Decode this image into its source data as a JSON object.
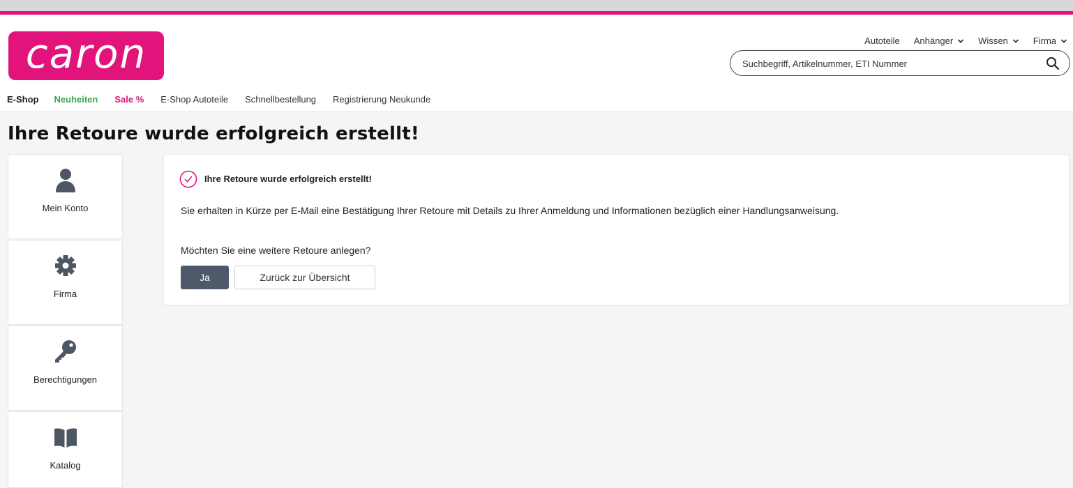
{
  "brand": {
    "logo_text": "caron",
    "accent_color": "#e2147c"
  },
  "utility_nav": [
    {
      "label": "Autoteile",
      "has_dropdown": false
    },
    {
      "label": "Anhänger",
      "has_dropdown": true
    },
    {
      "label": "Wissen",
      "has_dropdown": true
    },
    {
      "label": "Firma",
      "has_dropdown": true
    }
  ],
  "search": {
    "placeholder": "Suchbegriff, Artikelnummer, ETI Nummer",
    "value": ""
  },
  "main_nav": [
    {
      "label": "E-Shop"
    },
    {
      "label": "Neuheiten"
    },
    {
      "label": "Sale %"
    },
    {
      "label": "E-Shop Autoteile"
    },
    {
      "label": "Schnellbestellung"
    },
    {
      "label": "Registrierung Neukunde"
    }
  ],
  "page_title": "Ihre Retoure wurde erfolgreich erstellt!",
  "sidebar": [
    {
      "label": "Mein Konto",
      "icon": "user-icon"
    },
    {
      "label": "Firma",
      "icon": "gear-icon"
    },
    {
      "label": "Berechtigungen",
      "icon": "key-icon"
    },
    {
      "label": "Katalog",
      "icon": "book-icon"
    }
  ],
  "confirmation": {
    "title": "Ihre Retoure wurde erfolgreich erstellt!",
    "message": "Sie erhalten in Kürze per E-Mail eine Bestätigung Ihrer Retoure mit Details zu Ihrer Anmeldung und Informationen bezüglich einer Handlungsanweisung.",
    "question": "Möchten Sie eine weitere Retoure anlegen?",
    "yes_button": "Ja",
    "back_button": "Zurück zur Übersicht"
  }
}
